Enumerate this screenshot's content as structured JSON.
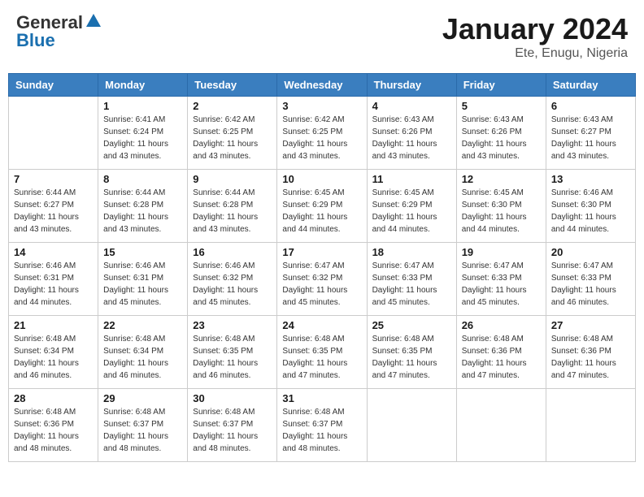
{
  "header": {
    "logo_general": "General",
    "logo_blue": "Blue",
    "month_title": "January 2024",
    "location": "Ete, Enugu, Nigeria"
  },
  "days_of_week": [
    "Sunday",
    "Monday",
    "Tuesday",
    "Wednesday",
    "Thursday",
    "Friday",
    "Saturday"
  ],
  "weeks": [
    [
      {
        "day": "",
        "sunrise": "",
        "sunset": "",
        "daylight": ""
      },
      {
        "day": "1",
        "sunrise": "Sunrise: 6:41 AM",
        "sunset": "Sunset: 6:24 PM",
        "daylight": "Daylight: 11 hours and 43 minutes."
      },
      {
        "day": "2",
        "sunrise": "Sunrise: 6:42 AM",
        "sunset": "Sunset: 6:25 PM",
        "daylight": "Daylight: 11 hours and 43 minutes."
      },
      {
        "day": "3",
        "sunrise": "Sunrise: 6:42 AM",
        "sunset": "Sunset: 6:25 PM",
        "daylight": "Daylight: 11 hours and 43 minutes."
      },
      {
        "day": "4",
        "sunrise": "Sunrise: 6:43 AM",
        "sunset": "Sunset: 6:26 PM",
        "daylight": "Daylight: 11 hours and 43 minutes."
      },
      {
        "day": "5",
        "sunrise": "Sunrise: 6:43 AM",
        "sunset": "Sunset: 6:26 PM",
        "daylight": "Daylight: 11 hours and 43 minutes."
      },
      {
        "day": "6",
        "sunrise": "Sunrise: 6:43 AM",
        "sunset": "Sunset: 6:27 PM",
        "daylight": "Daylight: 11 hours and 43 minutes."
      }
    ],
    [
      {
        "day": "7",
        "sunrise": "Sunrise: 6:44 AM",
        "sunset": "Sunset: 6:27 PM",
        "daylight": "Daylight: 11 hours and 43 minutes."
      },
      {
        "day": "8",
        "sunrise": "Sunrise: 6:44 AM",
        "sunset": "Sunset: 6:28 PM",
        "daylight": "Daylight: 11 hours and 43 minutes."
      },
      {
        "day": "9",
        "sunrise": "Sunrise: 6:44 AM",
        "sunset": "Sunset: 6:28 PM",
        "daylight": "Daylight: 11 hours and 43 minutes."
      },
      {
        "day": "10",
        "sunrise": "Sunrise: 6:45 AM",
        "sunset": "Sunset: 6:29 PM",
        "daylight": "Daylight: 11 hours and 44 minutes."
      },
      {
        "day": "11",
        "sunrise": "Sunrise: 6:45 AM",
        "sunset": "Sunset: 6:29 PM",
        "daylight": "Daylight: 11 hours and 44 minutes."
      },
      {
        "day": "12",
        "sunrise": "Sunrise: 6:45 AM",
        "sunset": "Sunset: 6:30 PM",
        "daylight": "Daylight: 11 hours and 44 minutes."
      },
      {
        "day": "13",
        "sunrise": "Sunrise: 6:46 AM",
        "sunset": "Sunset: 6:30 PM",
        "daylight": "Daylight: 11 hours and 44 minutes."
      }
    ],
    [
      {
        "day": "14",
        "sunrise": "Sunrise: 6:46 AM",
        "sunset": "Sunset: 6:31 PM",
        "daylight": "Daylight: 11 hours and 44 minutes."
      },
      {
        "day": "15",
        "sunrise": "Sunrise: 6:46 AM",
        "sunset": "Sunset: 6:31 PM",
        "daylight": "Daylight: 11 hours and 45 minutes."
      },
      {
        "day": "16",
        "sunrise": "Sunrise: 6:46 AM",
        "sunset": "Sunset: 6:32 PM",
        "daylight": "Daylight: 11 hours and 45 minutes."
      },
      {
        "day": "17",
        "sunrise": "Sunrise: 6:47 AM",
        "sunset": "Sunset: 6:32 PM",
        "daylight": "Daylight: 11 hours and 45 minutes."
      },
      {
        "day": "18",
        "sunrise": "Sunrise: 6:47 AM",
        "sunset": "Sunset: 6:33 PM",
        "daylight": "Daylight: 11 hours and 45 minutes."
      },
      {
        "day": "19",
        "sunrise": "Sunrise: 6:47 AM",
        "sunset": "Sunset: 6:33 PM",
        "daylight": "Daylight: 11 hours and 45 minutes."
      },
      {
        "day": "20",
        "sunrise": "Sunrise: 6:47 AM",
        "sunset": "Sunset: 6:33 PM",
        "daylight": "Daylight: 11 hours and 46 minutes."
      }
    ],
    [
      {
        "day": "21",
        "sunrise": "Sunrise: 6:48 AM",
        "sunset": "Sunset: 6:34 PM",
        "daylight": "Daylight: 11 hours and 46 minutes."
      },
      {
        "day": "22",
        "sunrise": "Sunrise: 6:48 AM",
        "sunset": "Sunset: 6:34 PM",
        "daylight": "Daylight: 11 hours and 46 minutes."
      },
      {
        "day": "23",
        "sunrise": "Sunrise: 6:48 AM",
        "sunset": "Sunset: 6:35 PM",
        "daylight": "Daylight: 11 hours and 46 minutes."
      },
      {
        "day": "24",
        "sunrise": "Sunrise: 6:48 AM",
        "sunset": "Sunset: 6:35 PM",
        "daylight": "Daylight: 11 hours and 47 minutes."
      },
      {
        "day": "25",
        "sunrise": "Sunrise: 6:48 AM",
        "sunset": "Sunset: 6:35 PM",
        "daylight": "Daylight: 11 hours and 47 minutes."
      },
      {
        "day": "26",
        "sunrise": "Sunrise: 6:48 AM",
        "sunset": "Sunset: 6:36 PM",
        "daylight": "Daylight: 11 hours and 47 minutes."
      },
      {
        "day": "27",
        "sunrise": "Sunrise: 6:48 AM",
        "sunset": "Sunset: 6:36 PM",
        "daylight": "Daylight: 11 hours and 47 minutes."
      }
    ],
    [
      {
        "day": "28",
        "sunrise": "Sunrise: 6:48 AM",
        "sunset": "Sunset: 6:36 PM",
        "daylight": "Daylight: 11 hours and 48 minutes."
      },
      {
        "day": "29",
        "sunrise": "Sunrise: 6:48 AM",
        "sunset": "Sunset: 6:37 PM",
        "daylight": "Daylight: 11 hours and 48 minutes."
      },
      {
        "day": "30",
        "sunrise": "Sunrise: 6:48 AM",
        "sunset": "Sunset: 6:37 PM",
        "daylight": "Daylight: 11 hours and 48 minutes."
      },
      {
        "day": "31",
        "sunrise": "Sunrise: 6:48 AM",
        "sunset": "Sunset: 6:37 PM",
        "daylight": "Daylight: 11 hours and 48 minutes."
      },
      {
        "day": "",
        "sunrise": "",
        "sunset": "",
        "daylight": ""
      },
      {
        "day": "",
        "sunrise": "",
        "sunset": "",
        "daylight": ""
      },
      {
        "day": "",
        "sunrise": "",
        "sunset": "",
        "daylight": ""
      }
    ]
  ]
}
